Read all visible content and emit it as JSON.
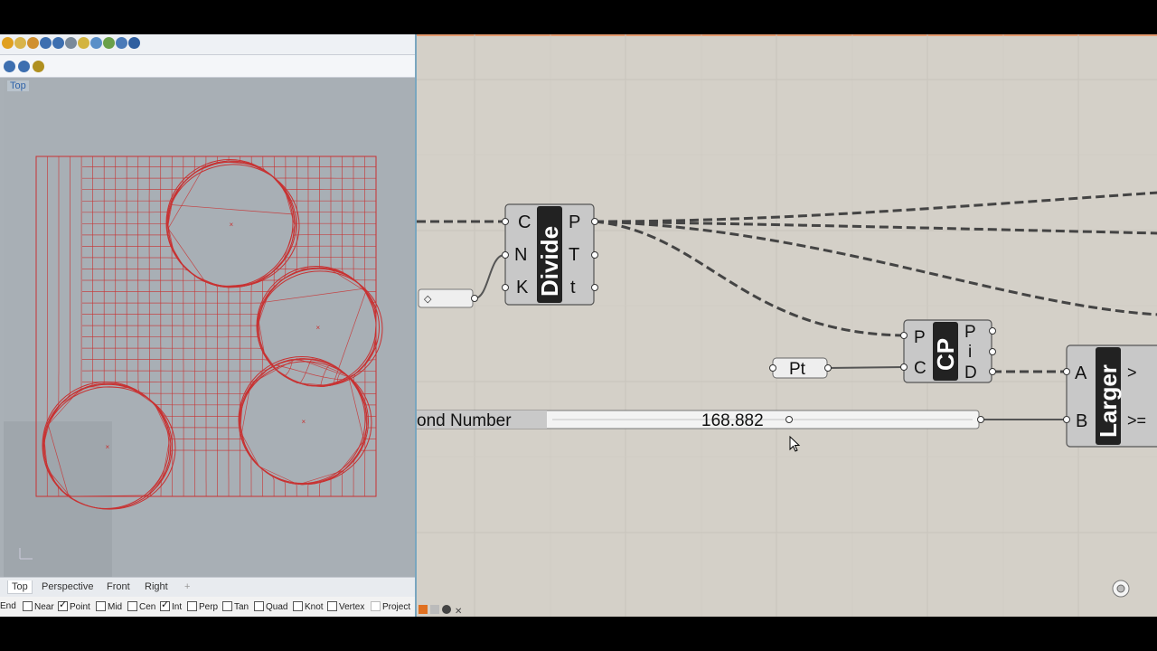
{
  "rhino": {
    "toolbar_icons": [
      "blue-r-icon",
      "magnify-icon",
      "green-m-icon"
    ],
    "viewport_title": "Top",
    "viewport_tabs": [
      "Top",
      "Perspective",
      "Front",
      "Right",
      "+"
    ],
    "active_tab": "Top",
    "osnaps": [
      {
        "label": "End",
        "checked": false
      },
      {
        "label": "Near",
        "checked": false
      },
      {
        "label": "Point",
        "checked": true
      },
      {
        "label": "Mid",
        "checked": false
      },
      {
        "label": "Cen",
        "checked": false
      },
      {
        "label": "Int",
        "checked": true
      },
      {
        "label": "Perp",
        "checked": false
      },
      {
        "label": "Tan",
        "checked": false
      },
      {
        "label": "Quad",
        "checked": false
      },
      {
        "label": "Knot",
        "checked": false
      },
      {
        "label": "Vertex",
        "checked": false
      },
      {
        "label": "Project",
        "checked": false
      }
    ],
    "curve_color": "#c83232"
  },
  "grasshopper": {
    "divide": {
      "inputs": [
        "C",
        "N",
        "K"
      ],
      "title": "Divide",
      "outputs": [
        "P",
        "T",
        "t"
      ]
    },
    "cp": {
      "inputs": [
        "P",
        "C"
      ],
      "title": "CP",
      "outputs": [
        "P",
        "i",
        "D"
      ]
    },
    "pt_param": "Pt",
    "larger": {
      "inputs": [
        "A",
        "B"
      ],
      "title": "Larger",
      "outputs": [
        ">",
        ">="
      ]
    },
    "slider": {
      "label": "ond Number",
      "value": "168.882"
    },
    "canvas_color": "#d4d0c8"
  }
}
